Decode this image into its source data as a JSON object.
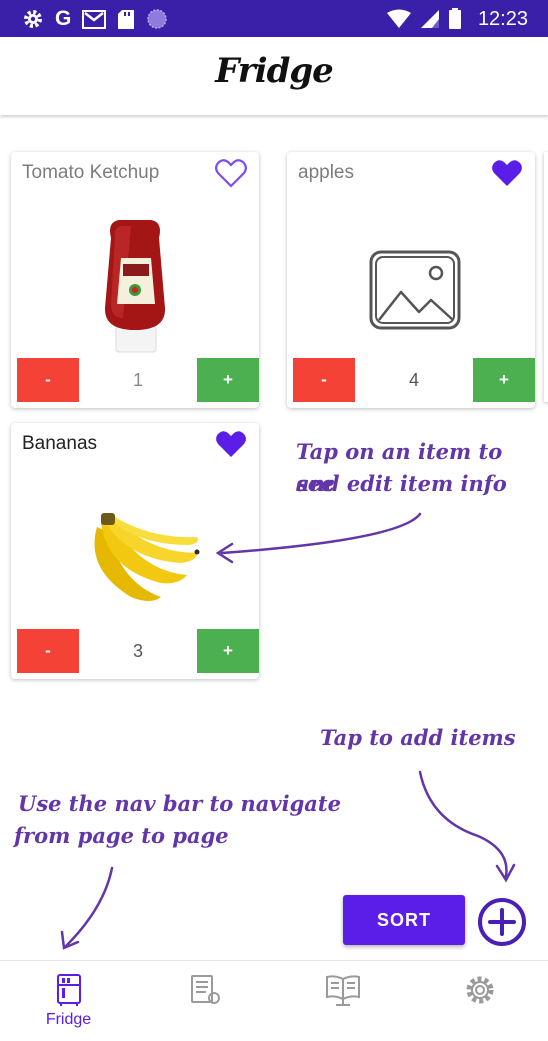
{
  "status_bar": {
    "time": "12:23",
    "google_letter": "G",
    "left_icons": [
      "settings-icon",
      "google-icon",
      "gmail-icon",
      "sd-card-icon",
      "circle-icon"
    ],
    "right_icons": [
      "wifi-icon",
      "signal-icon",
      "battery-icon"
    ]
  },
  "app": {
    "title": "Fridge"
  },
  "items": [
    {
      "name": "Tomato Ketchup",
      "quantity": "1",
      "favorite": false,
      "image": "ketchup-bottle"
    },
    {
      "name": "apples",
      "quantity": "4",
      "favorite": true,
      "image": "placeholder-image"
    },
    {
      "name": "Bananas",
      "quantity": "3",
      "favorite": true,
      "image": "bananas"
    }
  ],
  "buttons": {
    "minus_label": "-",
    "plus_label": "+",
    "sort_label": "SORT"
  },
  "annotations": {
    "item_tip_line1": "Tap on an item to see",
    "item_tip_line2": "and edit item info",
    "add_tip": "Tap to add items",
    "nav_tip_line1": "Use the nav bar to navigate",
    "nav_tip_line2": "from page to page"
  },
  "nav": [
    {
      "label": "Fridge",
      "icon": "fridge-icon",
      "active": true
    },
    {
      "label": "",
      "icon": "list-icon",
      "active": false
    },
    {
      "label": "",
      "icon": "recipe-book-icon",
      "active": false
    },
    {
      "label": "",
      "icon": "gear-icon",
      "active": false
    }
  ],
  "colors": {
    "status_bar": "#3a1fa8",
    "accent": "#5a1ee8",
    "minus": "#f44336",
    "plus": "#4caf50",
    "annotation": "#6236a8"
  }
}
